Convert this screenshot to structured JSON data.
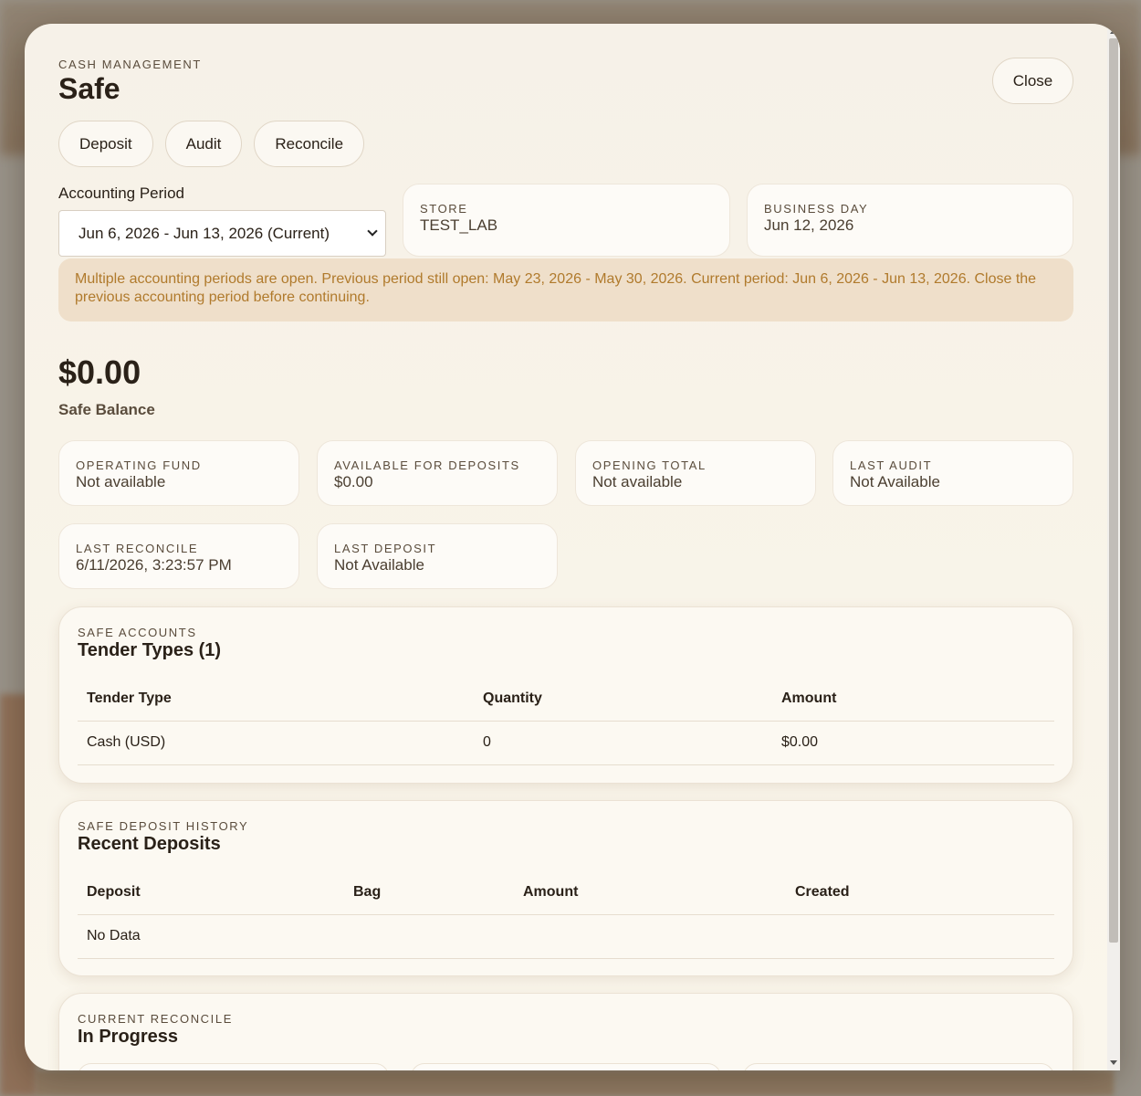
{
  "header": {
    "eyebrow": "CASH MANAGEMENT",
    "title": "Safe",
    "close_label": "Close"
  },
  "actions": [
    {
      "label": "Deposit"
    },
    {
      "label": "Audit"
    },
    {
      "label": "Reconcile"
    }
  ],
  "period": {
    "label": "Accounting Period",
    "selected": "Jun 6, 2026 - Jun 13, 2026 (Current)"
  },
  "store": {
    "label": "STORE",
    "value": "TEST_LAB"
  },
  "business_day": {
    "label": "BUSINESS DAY",
    "value": "Jun 12, 2026"
  },
  "alert": "Multiple accounting periods are open. Previous period still open: May 23, 2026 - May 30, 2026. Current period: Jun 6, 2026 - Jun 13, 2026. Close the previous accounting period before continuing.",
  "balance": {
    "amount": "$0.00",
    "label": "Safe Balance"
  },
  "stats": [
    {
      "label": "OPERATING FUND",
      "value": "Not available"
    },
    {
      "label": "AVAILABLE FOR DEPOSITS",
      "value": "$0.00"
    },
    {
      "label": "OPENING TOTAL",
      "value": "Not available"
    },
    {
      "label": "LAST AUDIT",
      "value": "Not Available"
    },
    {
      "label": "LAST RECONCILE",
      "value": "6/11/2026, 3:23:57 PM"
    },
    {
      "label": "LAST DEPOSIT",
      "value": "Not Available"
    }
  ],
  "tender": {
    "eyebrow": "SAFE ACCOUNTS",
    "title": "Tender Types (1)",
    "columns": [
      "Tender Type",
      "Quantity",
      "Amount"
    ],
    "rows": [
      [
        "Cash (USD)",
        "0",
        "$0.00"
      ]
    ]
  },
  "deposits": {
    "eyebrow": "SAFE DEPOSIT HISTORY",
    "title": "Recent Deposits",
    "columns": [
      "Deposit",
      "Bag",
      "Amount",
      "Created"
    ],
    "empty": "No Data"
  },
  "reconcile": {
    "eyebrow": "CURRENT RECONCILE",
    "title": "In Progress"
  }
}
